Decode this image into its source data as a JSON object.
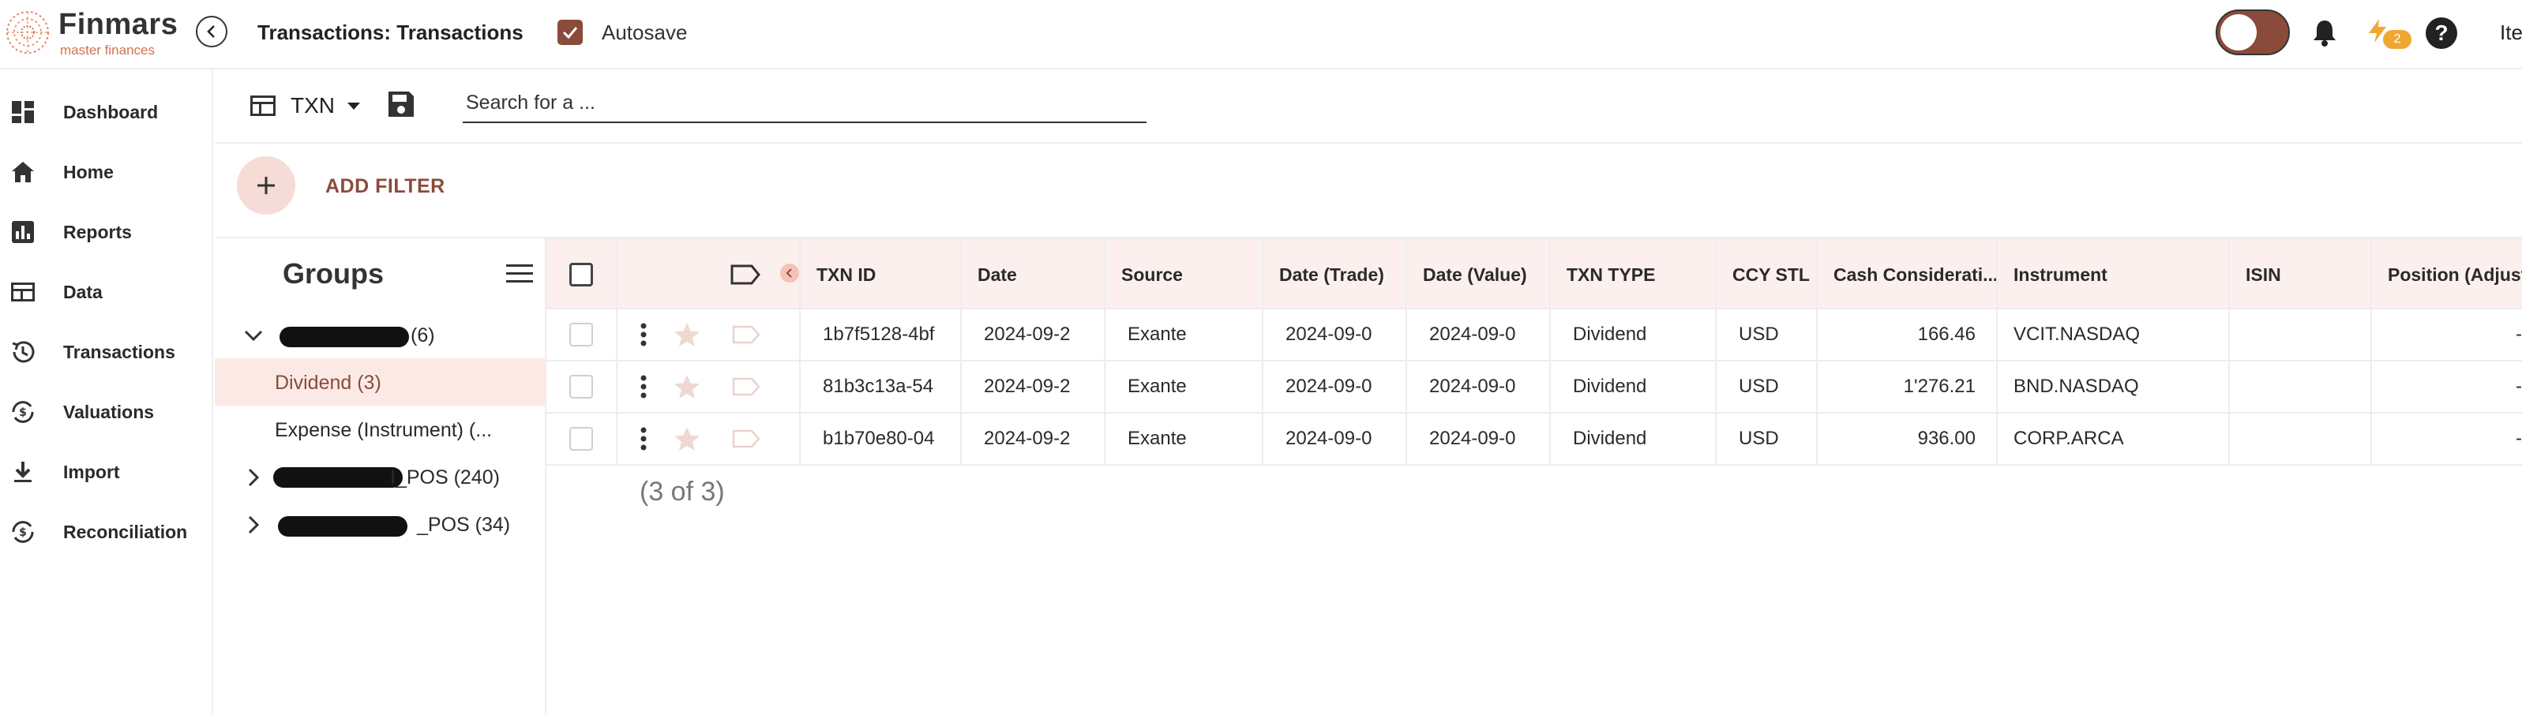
{
  "app": {
    "logo_name": "Finmars",
    "logo_tagline": "master finances",
    "page_title": "Transactions: Transactions",
    "autosave_label": "Autosave",
    "notification_count": "2",
    "help_glyph": "?",
    "user_name": "Ite",
    "accent_color": "#8a4b3a"
  },
  "sidebar": {
    "items": [
      {
        "label": "Dashboard",
        "icon": "dashboard-icon"
      },
      {
        "label": "Home",
        "icon": "home-icon"
      },
      {
        "label": "Reports",
        "icon": "reports-icon"
      },
      {
        "label": "Data",
        "icon": "data-icon"
      },
      {
        "label": "Transactions",
        "icon": "history-icon"
      },
      {
        "label": "Valuations",
        "icon": "valuations-icon"
      },
      {
        "label": "Import",
        "icon": "import-icon"
      },
      {
        "label": "Reconciliation",
        "icon": "reconciliation-icon"
      }
    ]
  },
  "toolbar": {
    "layout_name": "TXN",
    "search_placeholder": "Search for a ..."
  },
  "filters": {
    "add_filter_label": "ADD FILTER"
  },
  "groups": {
    "title": "Groups",
    "rows": [
      {
        "label": "(6)",
        "expanded": true,
        "selected": false,
        "redacted": true
      },
      {
        "label": "Dividend (3)",
        "expanded": false,
        "selected": true,
        "redacted": false
      },
      {
        "label": "Expense (Instrument) (...",
        "expanded": false,
        "selected": false,
        "redacted": false
      },
      {
        "label": "I_POS (240)",
        "expanded": false,
        "selected": false,
        "redacted": true
      },
      {
        "label": "_POS (34)",
        "expanded": false,
        "selected": false,
        "redacted": true
      }
    ]
  },
  "grid": {
    "columns": [
      "TXN ID",
      "Date",
      "Source",
      "Date (Trade)",
      "Date (Value)",
      "TXN TYPE",
      "CCY STL",
      "Cash Considerati...",
      "Instrument",
      "ISIN",
      "Position (Adjuste"
    ],
    "rows": [
      {
        "txn_id": "1b7f5128-4bf",
        "date": "2024-09-2",
        "source": "Exante",
        "date_trade": "2024-09-0",
        "date_value": "2024-09-0",
        "txn_type": "Dividend",
        "ccy_stl": "USD",
        "cash": "166.46",
        "instrument": "VCIT.NASDAQ",
        "isin": "",
        "position": "-"
      },
      {
        "txn_id": "81b3c13a-54",
        "date": "2024-09-2",
        "source": "Exante",
        "date_trade": "2024-09-0",
        "date_value": "2024-09-0",
        "txn_type": "Dividend",
        "ccy_stl": "USD",
        "cash": "1'276.21",
        "instrument": "BND.NASDAQ",
        "isin": "",
        "position": "-"
      },
      {
        "txn_id": "b1b70e80-04",
        "date": "2024-09-2",
        "source": "Exante",
        "date_trade": "2024-09-0",
        "date_value": "2024-09-0",
        "txn_type": "Dividend",
        "ccy_stl": "USD",
        "cash": "936.00",
        "instrument": "CORP.ARCA",
        "isin": "",
        "position": "-"
      }
    ],
    "pager_text": "(3 of 3)"
  }
}
